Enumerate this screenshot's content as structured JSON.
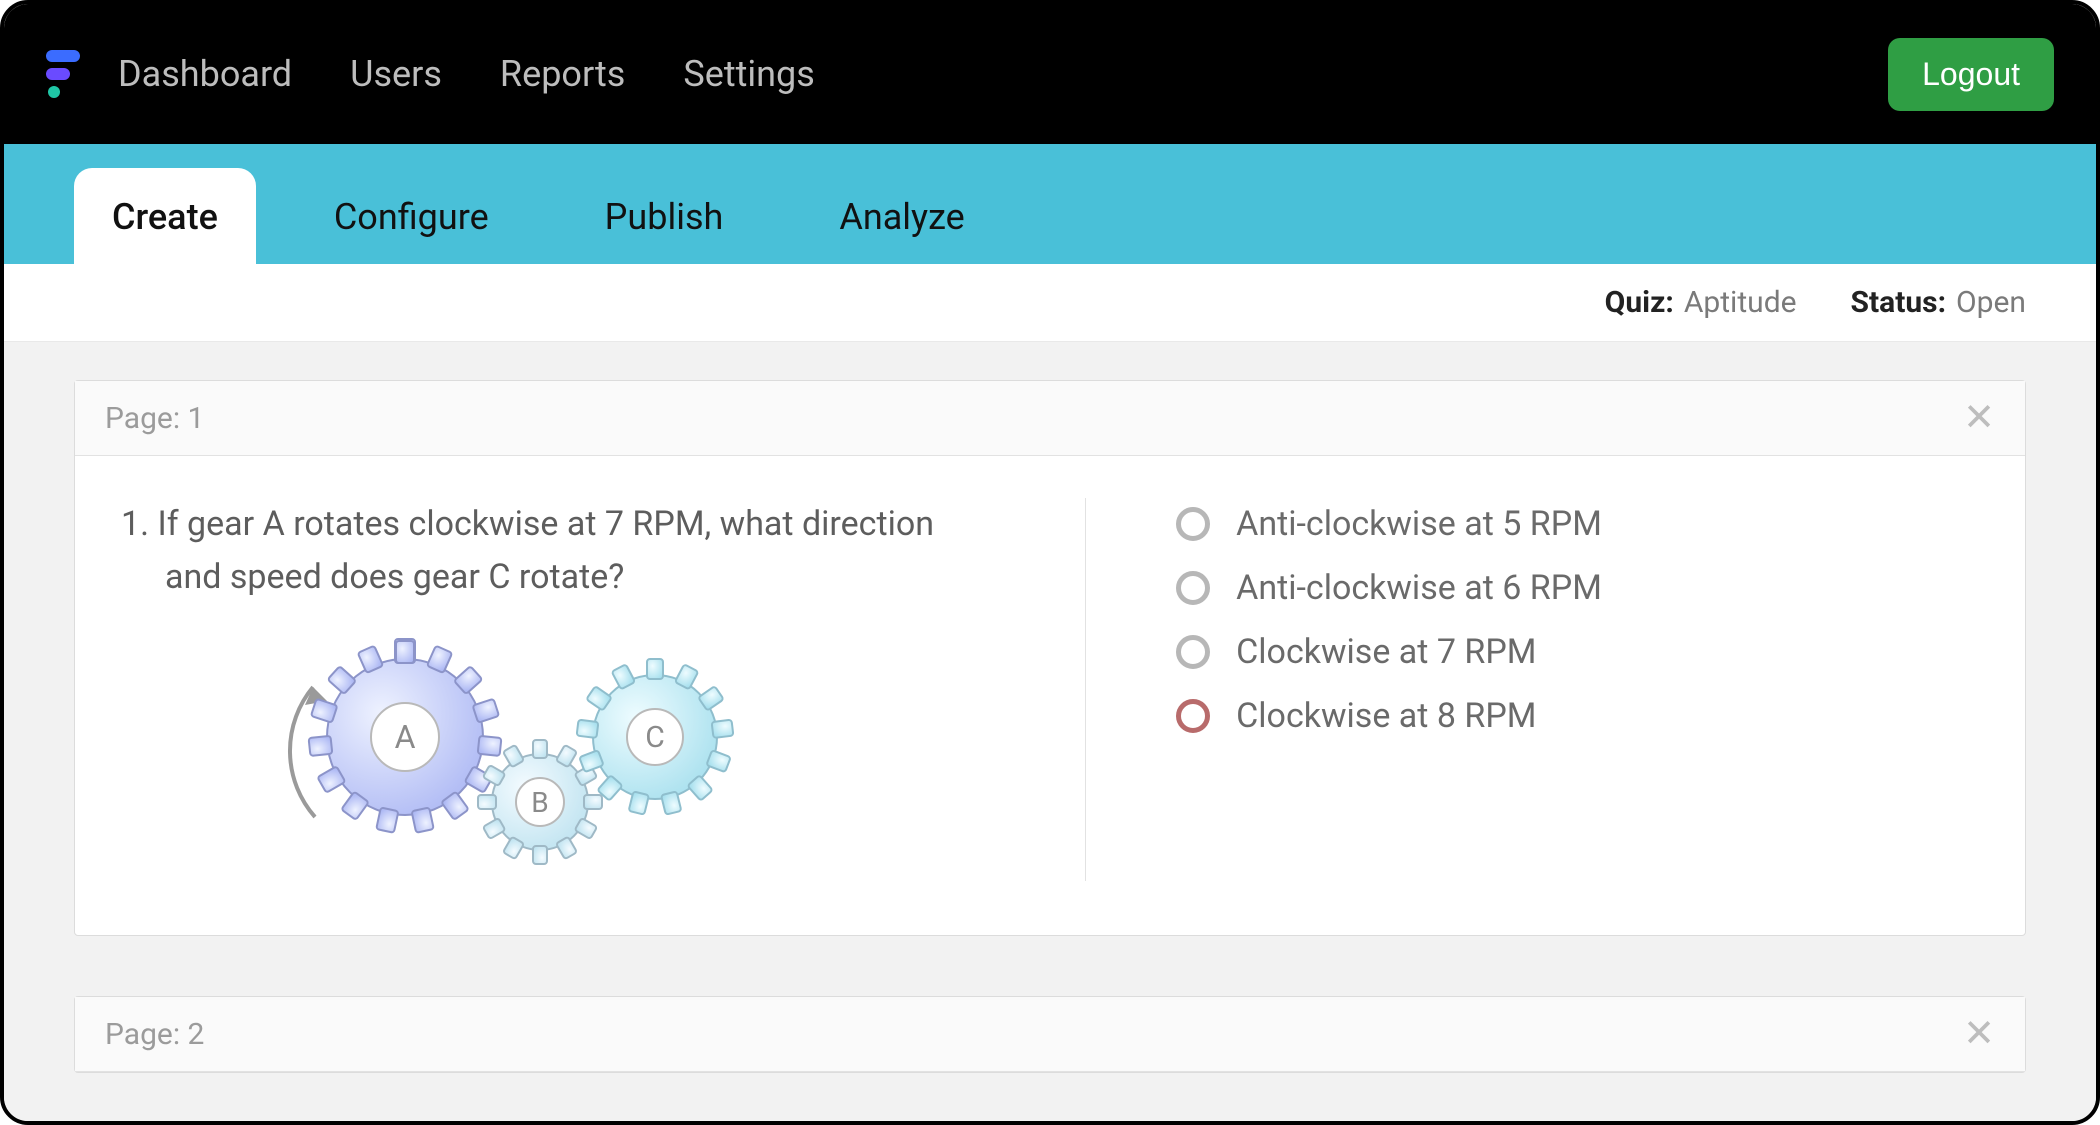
{
  "nav": {
    "items": [
      "Dashboard",
      "Users",
      "Reports",
      "Settings"
    ],
    "logout": "Logout"
  },
  "tabs": {
    "items": [
      "Create",
      "Configure",
      "Publish",
      "Analyze"
    ],
    "active_index": 0
  },
  "info": {
    "quiz_label": "Quiz:",
    "quiz_value": "Aptitude",
    "status_label": "Status:",
    "status_value": "Open"
  },
  "pages": [
    {
      "header": "Page: 1",
      "question": {
        "number": "1.",
        "text_line1": "If gear A rotates clockwise at 7 RPM, what direction",
        "text_line2": "and speed does gear C rotate?",
        "gear_labels": {
          "a": "A",
          "b": "B",
          "c": "C"
        }
      },
      "options": [
        "Anti-clockwise at 5 RPM",
        "Anti-clockwise at 6 RPM",
        "Clockwise at 7 RPM",
        "Clockwise at 8 RPM"
      ],
      "highlight_index": 3
    },
    {
      "header": "Page: 2"
    }
  ]
}
